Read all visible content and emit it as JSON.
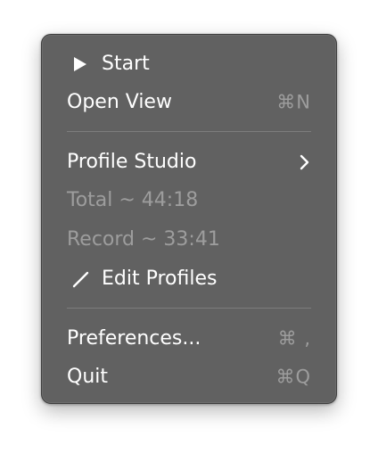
{
  "menu": {
    "items": [
      {
        "label": "Start",
        "icon": "play-icon"
      },
      {
        "label": "Open View",
        "shortcut": "⌘N"
      },
      {
        "label": "Profile Studio",
        "icon": "chevron-right-icon"
      },
      {
        "label": "Total ~ 44:18",
        "disabled": true
      },
      {
        "label": "Record ~ 33:41",
        "disabled": true
      },
      {
        "label": "Edit Profiles",
        "icon": "pencil-icon"
      },
      {
        "label": "Preferences...",
        "shortcut": "⌘ ,"
      },
      {
        "label": "Quit",
        "shortcut": "⌘Q"
      }
    ]
  },
  "colors": {
    "menu_background": "#616161",
    "text": "#ffffff",
    "disabled_text": "#9d9d9d",
    "separator": "#7d7d7d"
  }
}
